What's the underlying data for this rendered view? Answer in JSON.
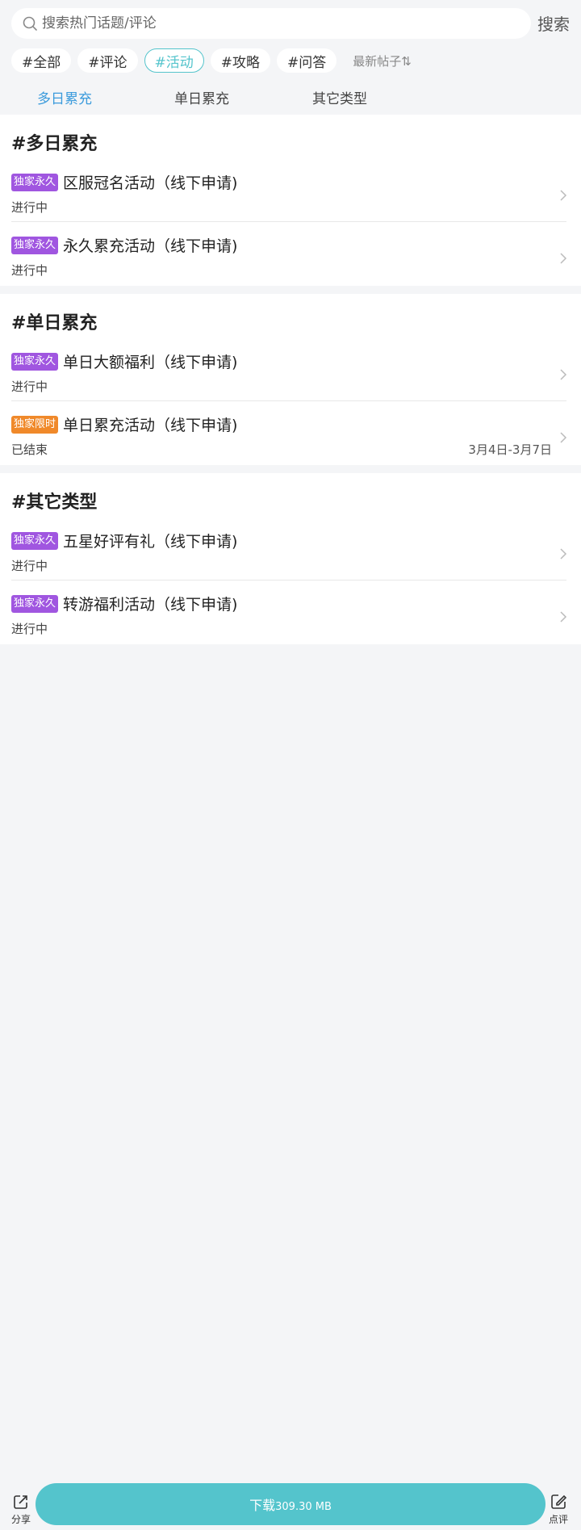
{
  "search": {
    "placeholder": "搜索热门话题/评论",
    "button_label": "搜索"
  },
  "chips": [
    "#全部",
    "#评论",
    "#活动",
    "#攻略",
    "#问答"
  ],
  "active_chip": "#活动",
  "sort_label": "最新帖子⇅",
  "tabs": [
    "多日累充",
    "单日累充",
    "其它类型"
  ],
  "active_tab": "多日累充",
  "colors": {
    "accent": "#54c4cc",
    "tab_active": "#3b9bdc",
    "badge_permanent": "#a056e0",
    "badge_limited": "#f0892a"
  },
  "sections": [
    {
      "title": "#多日累充",
      "items": [
        {
          "badge": "独家永久",
          "badge_type": "permanent",
          "title": "区服冠名活动（线下申请)",
          "status": "进行中",
          "date": ""
        },
        {
          "badge": "独家永久",
          "badge_type": "permanent",
          "title": "永久累充活动（线下申请)",
          "status": "进行中",
          "date": ""
        }
      ]
    },
    {
      "title": "#单日累充",
      "items": [
        {
          "badge": "独家永久",
          "badge_type": "permanent",
          "title": "单日大额福利（线下申请)",
          "status": "进行中",
          "date": ""
        },
        {
          "badge": "独家限时",
          "badge_type": "limited",
          "title": "单日累充活动（线下申请)",
          "status": "已结束",
          "date": "3月4日-3月7日"
        }
      ]
    },
    {
      "title": "#其它类型",
      "items": [
        {
          "badge": "独家永久",
          "badge_type": "permanent",
          "title": "五星好评有礼（线下申请)",
          "status": "进行中",
          "date": ""
        },
        {
          "badge": "独家永久",
          "badge_type": "permanent",
          "title": "转游福利活动（线下申请)",
          "status": "进行中",
          "date": ""
        }
      ]
    }
  ],
  "bottom": {
    "share_label": "分享",
    "download_label": "下载",
    "download_size": "309.30 MB",
    "review_label": "点评"
  }
}
